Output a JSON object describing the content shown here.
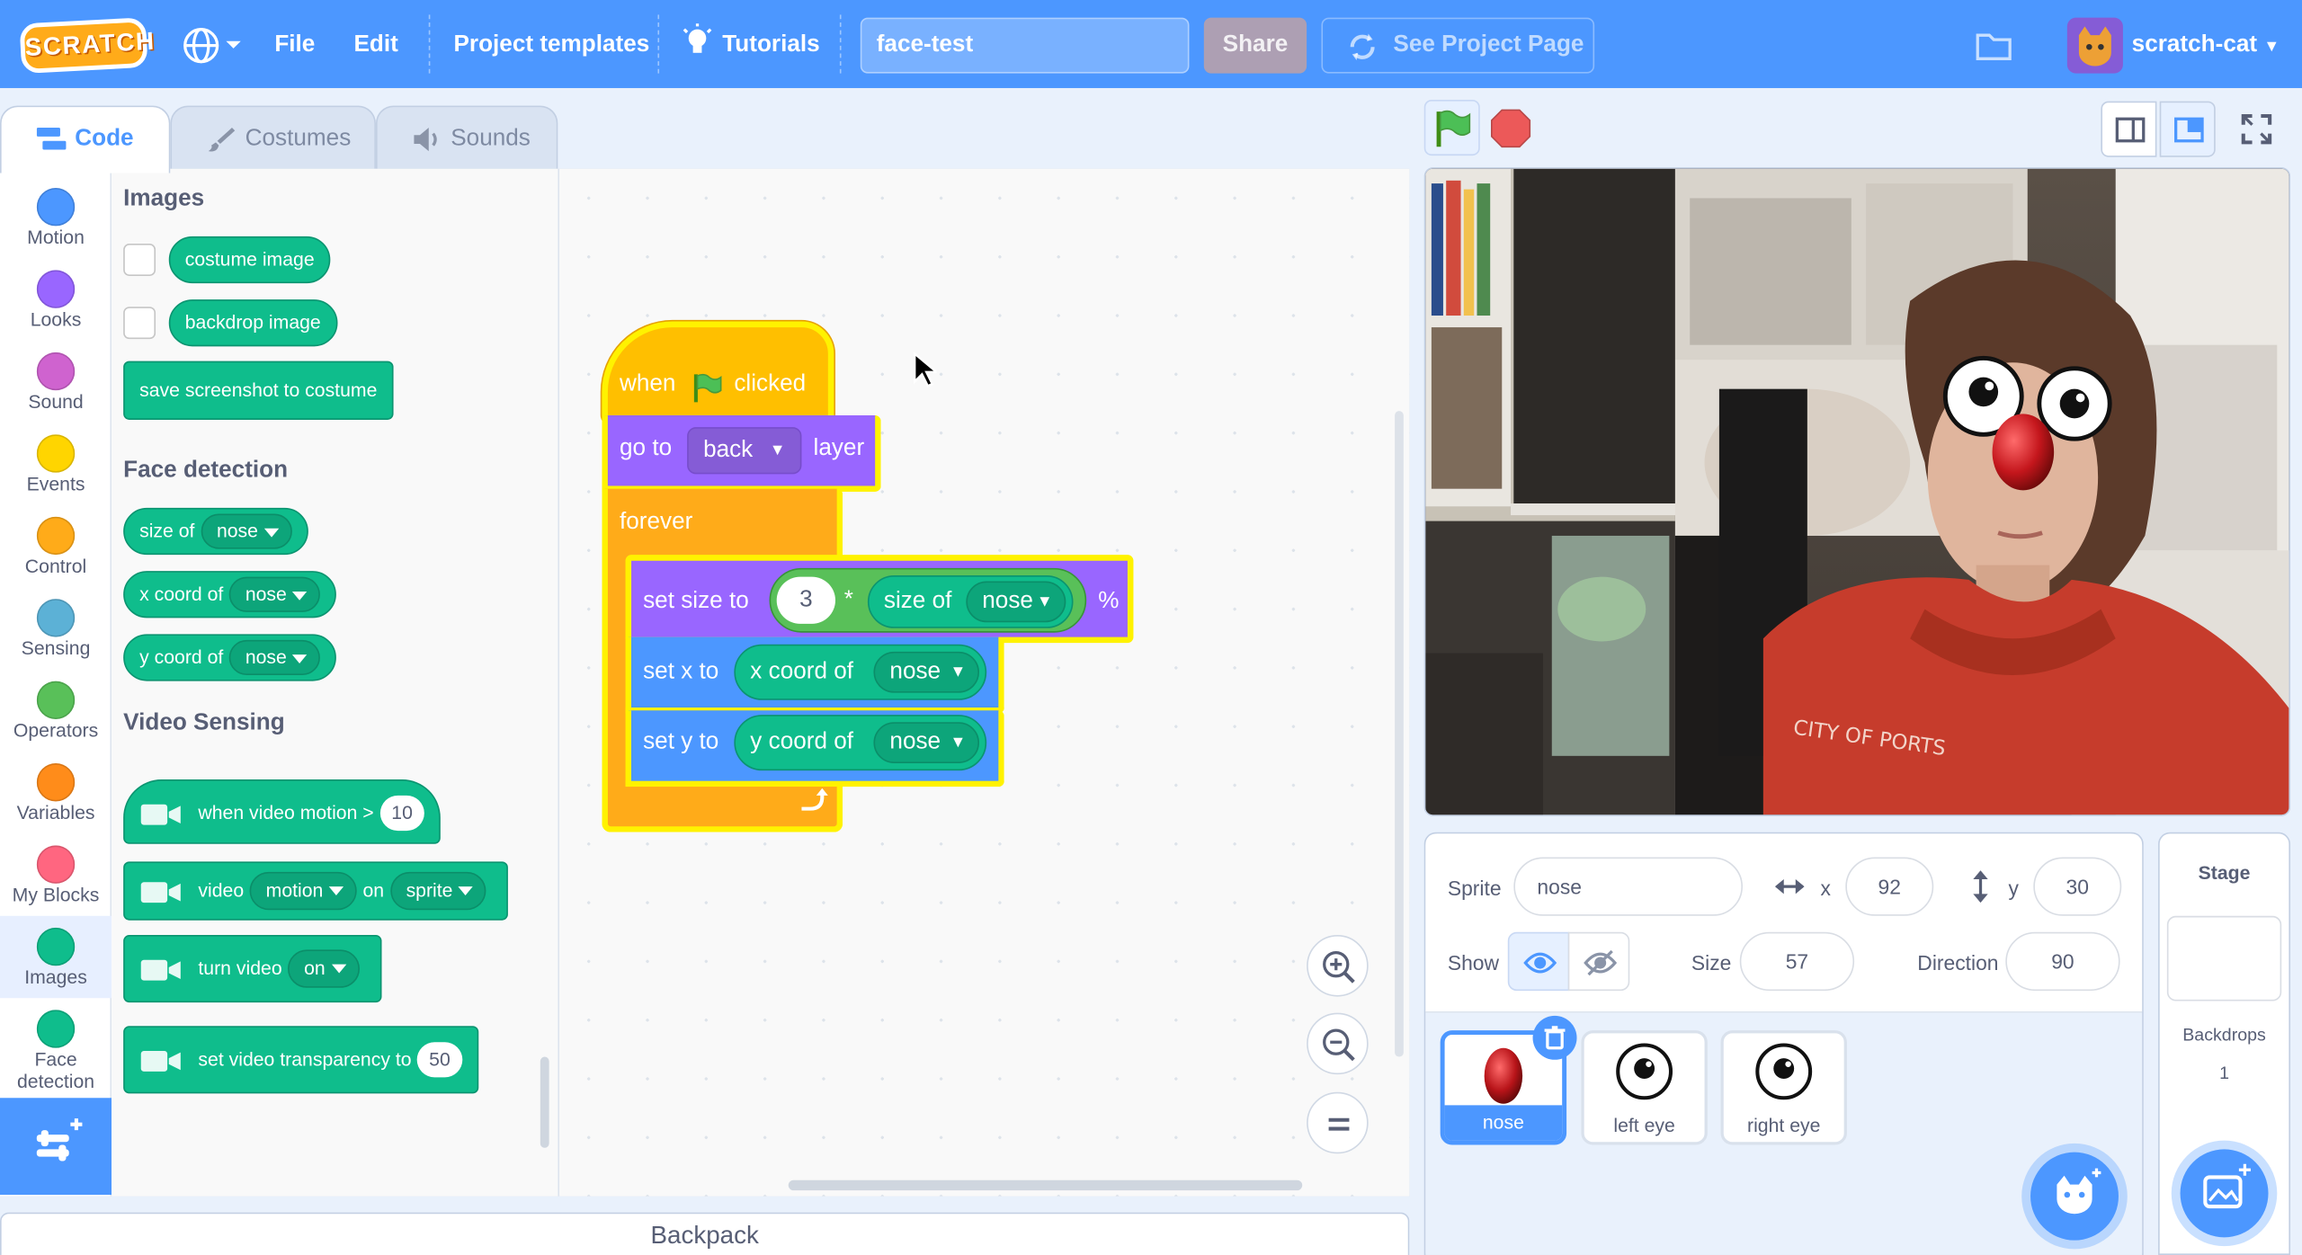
{
  "menu": {
    "logo": "SCRATCH",
    "file": "File",
    "edit": "Edit",
    "templates": "Project templates",
    "tutorials": "Tutorials",
    "project_title": "face-test",
    "share": "Share",
    "see_project": "See Project Page",
    "username": "scratch-cat"
  },
  "tabs": {
    "code": "Code",
    "costumes": "Costumes",
    "sounds": "Sounds"
  },
  "categories": [
    {
      "label": "Motion",
      "color": "#4c97ff"
    },
    {
      "label": "Looks",
      "color": "#9966ff"
    },
    {
      "label": "Sound",
      "color": "#cf63cf"
    },
    {
      "label": "Events",
      "color": "#ffd500"
    },
    {
      "label": "Control",
      "color": "#ffab19"
    },
    {
      "label": "Sensing",
      "color": "#5cb1d6"
    },
    {
      "label": "Operators",
      "color": "#59c059"
    },
    {
      "label": "Variables",
      "color": "#ff8c1a"
    },
    {
      "label": "My Blocks",
      "color": "#ff6680"
    },
    {
      "label": "Images",
      "color": "#0fbd8c"
    },
    {
      "label": "Face detection",
      "color": "#0fbd8c"
    }
  ],
  "palette": {
    "images_title": "Images",
    "costume_image": "costume image",
    "backdrop_image": "backdrop image",
    "save_screenshot": "save screenshot to costume",
    "face_title": "Face detection",
    "size_of": "size of",
    "x_coord_of": "x coord of",
    "y_coord_of": "y coord of",
    "nose": "nose",
    "video_title": "Video Sensing",
    "when_video_motion": "when video motion >",
    "motion_value": "10",
    "video": "video",
    "motion": "motion",
    "on": "on",
    "sprite": "sprite",
    "turn_video": "turn video",
    "on_value": "on",
    "set_transparency": "set video transparency to",
    "transparency_value": "50"
  },
  "script": {
    "when": "when",
    "clicked": "clicked",
    "go_to": "go to",
    "back": "back",
    "layer": "layer",
    "forever": "forever",
    "set_size_to": "set size to",
    "size_factor": "3",
    "times": "*",
    "size_of": "size of",
    "nose": "nose",
    "percent": "%",
    "set_x_to": "set x to",
    "x_coord_of": "x coord of",
    "set_y_to": "set y to",
    "y_coord_of": "y coord of"
  },
  "backpack": "Backpack",
  "sprite_info": {
    "sprite_label": "Sprite",
    "sprite_name": "nose",
    "x_label": "x",
    "x_value": "92",
    "y_label": "y",
    "y_value": "30",
    "show_label": "Show",
    "size_label": "Size",
    "size_value": "57",
    "direction_label": "Direction",
    "direction_value": "90"
  },
  "sprites": [
    {
      "name": "nose"
    },
    {
      "name": "left eye"
    },
    {
      "name": "right eye"
    }
  ],
  "stage_pane": {
    "title": "Stage",
    "backdrops_label": "Backdrops",
    "backdrops_count": "1"
  }
}
